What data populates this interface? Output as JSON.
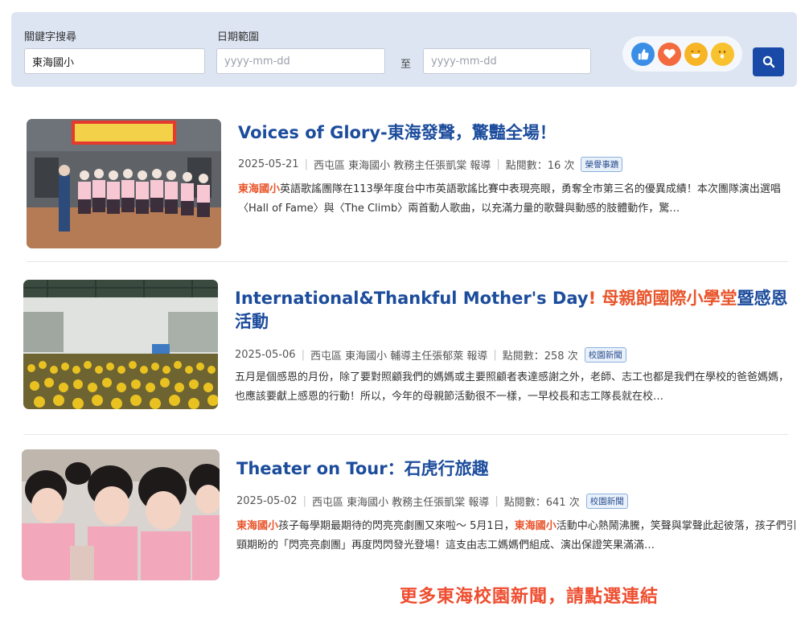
{
  "search": {
    "keyword_label": "關鍵字搜尋",
    "keyword_value": "東海國小",
    "date_label": "日期範圍",
    "date_placeholder": "yyyy-mm-dd",
    "to_label": "至",
    "reaction_icons": [
      "thumbs-up-icon",
      "heart-icon",
      "laugh-icon",
      "surprise-icon"
    ],
    "colors": {
      "panel": "#dde5f3",
      "button": "#1a4aa8"
    }
  },
  "articles": [
    {
      "title": "Voices of Glory-東海發聲，驚豔全場！",
      "date": "2025-05-21",
      "reporter": "西屯區 東海國小 教務主任張凱棠 報導",
      "views": "點閱數：16 次",
      "tag": "榮譽事蹟",
      "excerpt_hl": "東海國小",
      "excerpt_rest": "英語歌謠團隊在113學年度台中市英語歌謠比賽中表現亮眼，勇奪全市第三名的優異成績！本次團隊演出選唱〈Hall of Fame〉與〈The Climb〉兩首動人歌曲，以充滿力量的歌聲與動感的肢體動作，驚…"
    },
    {
      "title_a": "International&Thankful Mother's Day",
      "title_b": "! 母親節國際小學堂",
      "title_c": "暨感恩活動",
      "date": "2025-05-06",
      "reporter": "西屯區 東海國小 輔導主任張郁萊 報導",
      "views": "點閱數：258 次",
      "tag": "校園新聞",
      "excerpt": "五月是個感恩的月份，除了要對照顧我們的媽媽或主要照顧者表達感謝之外，老師、志工也都是我們在學校的爸爸媽媽，也應該要獻上感恩的行動！所以，今年的母親節活動很不一樣，一早校長和志工隊長就在校…"
    },
    {
      "title": "Theater on Tour：石虎行旅趣",
      "date": "2025-05-02",
      "reporter": "西屯區 東海國小 教務主任張凱棠 報導",
      "views": "點閱數：641 次",
      "tag": "校園新聞",
      "excerpt_hl1": "東海國小",
      "excerpt_mid": "孩子每學期最期待的閃亮亮劇團又來啦～ 5月1日，",
      "excerpt_hl2": "東海國小",
      "excerpt_rest": "活動中心熱鬧沸騰，笑聲與掌聲此起彼落，孩子們引頸期盼的「閃亮亮劇團」再度閃閃發光登場！這支由志工媽媽們組成、演出保證笑果滿滿…"
    }
  ],
  "more_link": "更多東海校園新聞，請點選連結",
  "colors": {
    "title": "#1c4c9c",
    "highlight": "#e8552b",
    "more": "#ef4d2f"
  }
}
